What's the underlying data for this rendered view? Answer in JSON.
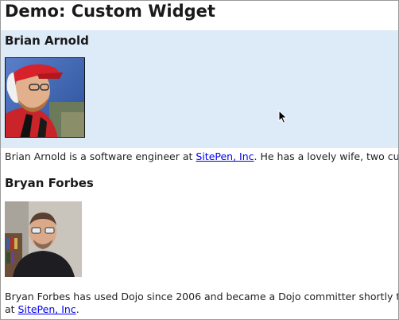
{
  "page": {
    "title": "Demo: Custom Widget"
  },
  "authors": [
    {
      "name": "Brian Arnold",
      "bio_before": "Brian Arnold is a software engineer at ",
      "link_text": "SitePen, Inc",
      "bio_after": ". He has a lovely wife, two cu"
    },
    {
      "name": "Bryan Forbes",
      "bio_line1": "Bryan Forbes has used Dojo since 2006 and became a Dojo committer shortly t",
      "bio_line2_before": "at ",
      "link_text": "SitePen, Inc",
      "bio_line2_after": "."
    }
  ],
  "colors": {
    "highlight": "#ddeaf8",
    "link": "#0000ee"
  },
  "icons": {
    "cursor": "mouse-pointer-icon"
  }
}
